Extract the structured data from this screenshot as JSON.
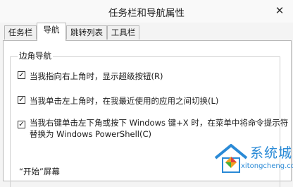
{
  "window": {
    "title": "任务栏和导航属性",
    "close_icon": "close-icon"
  },
  "tabs": [
    {
      "label": "任务栏",
      "active": false
    },
    {
      "label": "导航",
      "active": true
    },
    {
      "label": "跳转列表",
      "active": false
    },
    {
      "label": "工具栏",
      "active": false
    }
  ],
  "corner_nav": {
    "title": "边角导航",
    "options": [
      {
        "label": "当我指向右上角时，显示超级按钮(R)",
        "checked": true
      },
      {
        "label": "当我单击左上角时，在我最近使用的应用之间切换(L)",
        "checked": true
      },
      {
        "label_line1": "当我右键单击左下角或按下 Windows 键+X 时，在菜单中将命令提示符",
        "label_line2": "替换为 Windows PowerShell(C)",
        "checked": true
      }
    ]
  },
  "start_screen": {
    "title": "“开始”屏幕"
  },
  "watermark": {
    "text": "系统城",
    "url": "xitongcheng.com",
    "brand_color": "#2a8ad6"
  }
}
